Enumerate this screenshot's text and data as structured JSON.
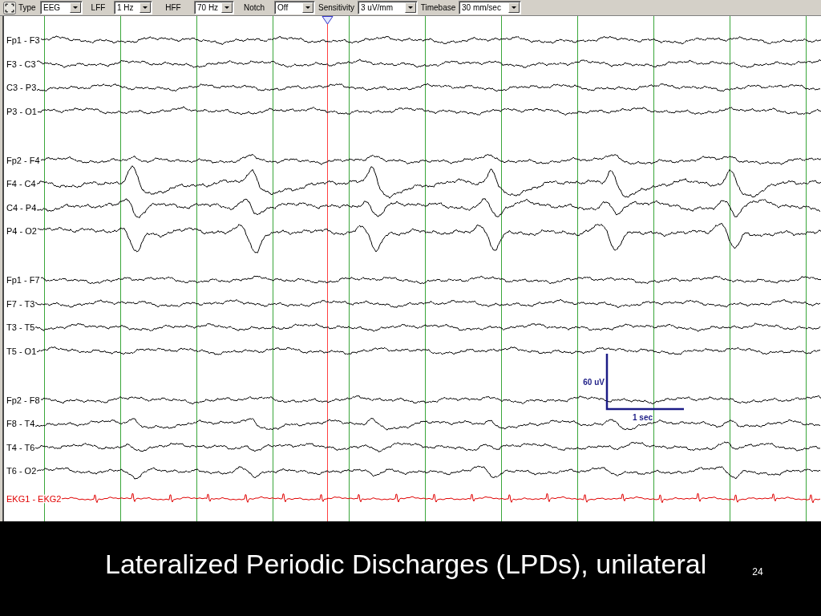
{
  "toolbar": {
    "fields": [
      {
        "label": "Type",
        "value": "EEG"
      },
      {
        "label": "LFF",
        "value": "1 Hz"
      },
      {
        "label": "HFF",
        "value": "70 Hz"
      },
      {
        "label": "Notch",
        "value": "Off"
      },
      {
        "label": "Sensitivity",
        "value": "3 uV/mm"
      },
      {
        "label": "Timebase",
        "value": "30 mm/sec"
      }
    ]
  },
  "eeg": {
    "groups": [
      {
        "channels": [
          {
            "label": "Fp1 - F3",
            "kind": "background"
          },
          {
            "label": "F3 - C3",
            "kind": "background"
          },
          {
            "label": "C3 - P3",
            "kind": "background"
          },
          {
            "label": "P3 - O1",
            "kind": "background"
          }
        ]
      },
      {
        "channels": [
          {
            "label": "Fp2 - F4",
            "kind": "mild"
          },
          {
            "label": "F4 - C4",
            "kind": "discharge"
          },
          {
            "label": "C4 - P4",
            "kind": "discharge"
          },
          {
            "label": "P4 - O2",
            "kind": "discharge"
          }
        ]
      },
      {
        "channels": [
          {
            "label": "Fp1 - F7",
            "kind": "background"
          },
          {
            "label": "F7 - T3",
            "kind": "background"
          },
          {
            "label": "T3 - T5",
            "kind": "background"
          },
          {
            "label": "T5 - O1",
            "kind": "background"
          }
        ]
      },
      {
        "channels": [
          {
            "label": "Fp2 - F8",
            "kind": "background"
          },
          {
            "label": "F8 - T4",
            "kind": "mild"
          },
          {
            "label": "T4 - T6",
            "kind": "mild"
          },
          {
            "label": "T6 - O2",
            "kind": "mild"
          }
        ]
      }
    ],
    "reference_channel": {
      "label": "EKG1 - EKG2",
      "kind": "ekg"
    },
    "calibration": {
      "amplitude": "60 uV",
      "duration": "1 sec"
    }
  },
  "caption": {
    "title": "Lateralized Periodic Discharges (LPDs), unilateral",
    "slide_number": "24"
  }
}
